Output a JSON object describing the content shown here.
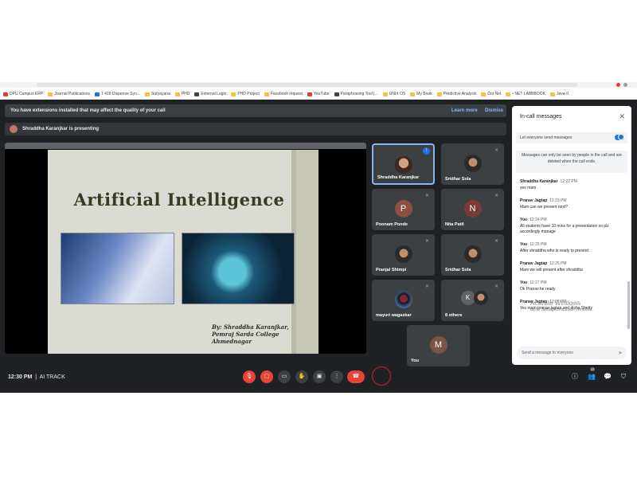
{
  "bookmarks": [
    "DPU Campus ERP",
    "Journal Publications",
    "1 428 Dispense Syn...",
    "Suryayana",
    "PHD",
    "External Login",
    "PHD Project",
    "Facebook request",
    "YouTube",
    "Paraphrasing Tool |...",
    "UNIX OS",
    "My Book",
    "Predictive Analysis",
    "Dot Net",
    "• NET LABBBOOK",
    "Java-II"
  ],
  "banner": {
    "extensions": "You have extensions installed that may affect the quality of your call",
    "learn_more": "Learn more",
    "dismiss": "Dismiss"
  },
  "presenting": "Shraddha Karanjkar is presenting",
  "slide": {
    "title": "Artificial Intelligence",
    "author_lines": [
      "By: Shraddha Karanjkar,",
      "Pemraj Sarda College",
      "Ahmednagar"
    ]
  },
  "participants": [
    {
      "name": "Shraddha Karanjkar",
      "avatar": "photo",
      "active": true
    },
    {
      "name": "Sridhar Sola",
      "avatar": "photo"
    },
    {
      "name": "Poonam Ponde",
      "initial": "P",
      "color": "#8d4f3f"
    },
    {
      "name": "Nita Patil",
      "initial": "N",
      "color": "#7a3b34"
    },
    {
      "name": "Pranjal Shimpi",
      "avatar": "photo"
    },
    {
      "name": "Sridhar Sola",
      "avatar": "photo"
    },
    {
      "name": "mayuri wagaskar",
      "avatar": "photo"
    },
    {
      "name": "8 others",
      "initial": "K",
      "color": "#5f6368"
    },
    {
      "name": "You",
      "initial": "M",
      "color": "#7b5448"
    }
  ],
  "bottom": {
    "time": "12:30 PM",
    "meeting": "AI TRACK",
    "people_count": "17"
  },
  "chat": {
    "title": "In-call messages",
    "toggle_label": "Let everyone send messages",
    "notice": "Messages can only be seen by people in the call and are deleted when the call ends.",
    "messages": [
      {
        "sender": "Shraddha Karanjkar",
        "time": "12:22 PM",
        "text": "yes mam"
      },
      {
        "sender": "Pranav Jagtap",
        "time": "12:23 PM",
        "text": "Mam can we present next?"
      },
      {
        "sender": "You",
        "time": "12:24 PM",
        "text": "All students have 10 mins for a presentation so plz accordingly  manage"
      },
      {
        "sender": "You",
        "time": "12:25 PM",
        "text": "After shraddha who is ready to present"
      },
      {
        "sender": "Pranav Jagtap",
        "time": "12:25 PM",
        "text": "Mam we will present after shraddha"
      },
      {
        "sender": "You",
        "time": "12:27 PM",
        "text": "Ok Pranav be ready"
      },
      {
        "sender": "Pranav Jagtap",
        "time": "12:27 PM",
        "text": "Yes mam pranav jagtap and disha Shetty"
      }
    ],
    "input_placeholder": "Send a message to everyone"
  },
  "watermark": {
    "line1": "Activate Windows",
    "line2": "Go to Settings to activate Windows."
  }
}
